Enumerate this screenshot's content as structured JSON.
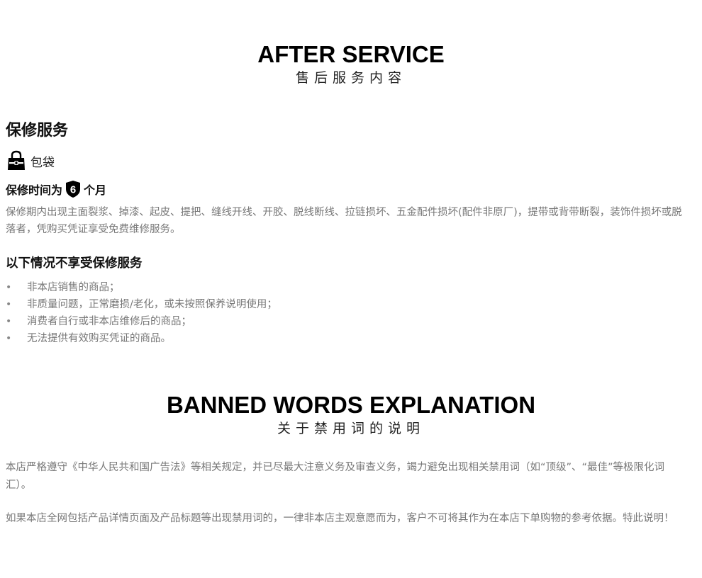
{
  "after_service": {
    "title": "AFTER SERVICE",
    "subtitle": "售后服务内容"
  },
  "warranty": {
    "heading": "保修服务",
    "category": {
      "icon": "handbag-icon",
      "label": "包袋"
    },
    "period": {
      "prefix": "保修时间为",
      "months": "6",
      "suffix": "个月",
      "badge_icon": "shield-icon"
    },
    "coverage": "保修期内出现主面裂浆、掉漆、起皮、提把、缝线开线、开胶、脱线断线、拉链损坏、五金配件损坏(配件非原厂)，提带或背带断裂，装饰件损坏或脱落者，凭购买凭证享受免费维修服务。"
  },
  "exclusions": {
    "heading": "以下情况不享受保修服务",
    "items": [
      "非本店销售的商品；",
      "非质量问题，正常磨损/老化，或未按照保养说明使用；",
      "消费者自行或非本店维修后的商品；",
      "无法提供有效购买凭证的商品。"
    ]
  },
  "banned_words": {
    "title": "BANNED WORDS EXPLANATION",
    "subtitle": "关于禁用词的说明",
    "paragraph_1": "本店严格遵守《中华人民共和国广告法》等相关规定，并已尽最大注意义务及审查义务，竭力避免出现相关禁用词（如“顶级”、“最佳”等极限化词汇）。",
    "paragraph_2": "如果本店全网包括产品详情页面及产品标题等出现禁用词的，一律非本店主观意愿而为，客户不可将其作为在本店下单购物的参考依据。特此说明！"
  },
  "colors": {
    "heading": "#111111",
    "body_text": "#777777",
    "icon": "#000000"
  }
}
